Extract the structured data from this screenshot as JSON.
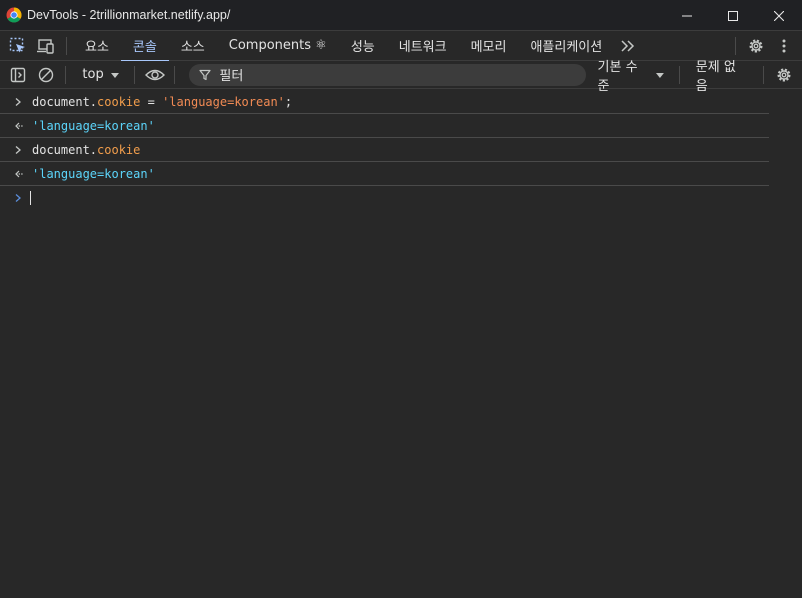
{
  "window": {
    "title": "DevTools - 2trillionmarket.netlify.app/"
  },
  "tabs": [
    {
      "label": "요소"
    },
    {
      "label": "콘솔",
      "active": true
    },
    {
      "label": "소스"
    },
    {
      "label": "Components ⚛"
    },
    {
      "label": "성능"
    },
    {
      "label": "네트워크"
    },
    {
      "label": "메모리"
    },
    {
      "label": "애플리케이션"
    }
  ],
  "toolbar": {
    "context": "top",
    "filter_placeholder": "필터",
    "levels": "기본 수준",
    "issues": "문제 없음"
  },
  "console": {
    "entries": [
      {
        "type": "input",
        "parts": [
          [
            "document.",
            "plain"
          ],
          [
            "cookie",
            "prop"
          ],
          [
            " = ",
            "plain"
          ],
          [
            "'language=korean'",
            "str"
          ],
          [
            ";",
            "plain"
          ]
        ]
      },
      {
        "type": "result",
        "parts": [
          [
            "'language=korean'",
            "res"
          ]
        ]
      },
      {
        "type": "input",
        "parts": [
          [
            "document.",
            "plain"
          ],
          [
            "cookie",
            "prop"
          ]
        ]
      },
      {
        "type": "result",
        "parts": [
          [
            "'language=korean'",
            "res"
          ]
        ]
      }
    ]
  },
  "colors": {
    "accent": "#a8c7fa",
    "string": "#f28b54",
    "property": "#f29e4c",
    "result": "#5cd5fb"
  }
}
